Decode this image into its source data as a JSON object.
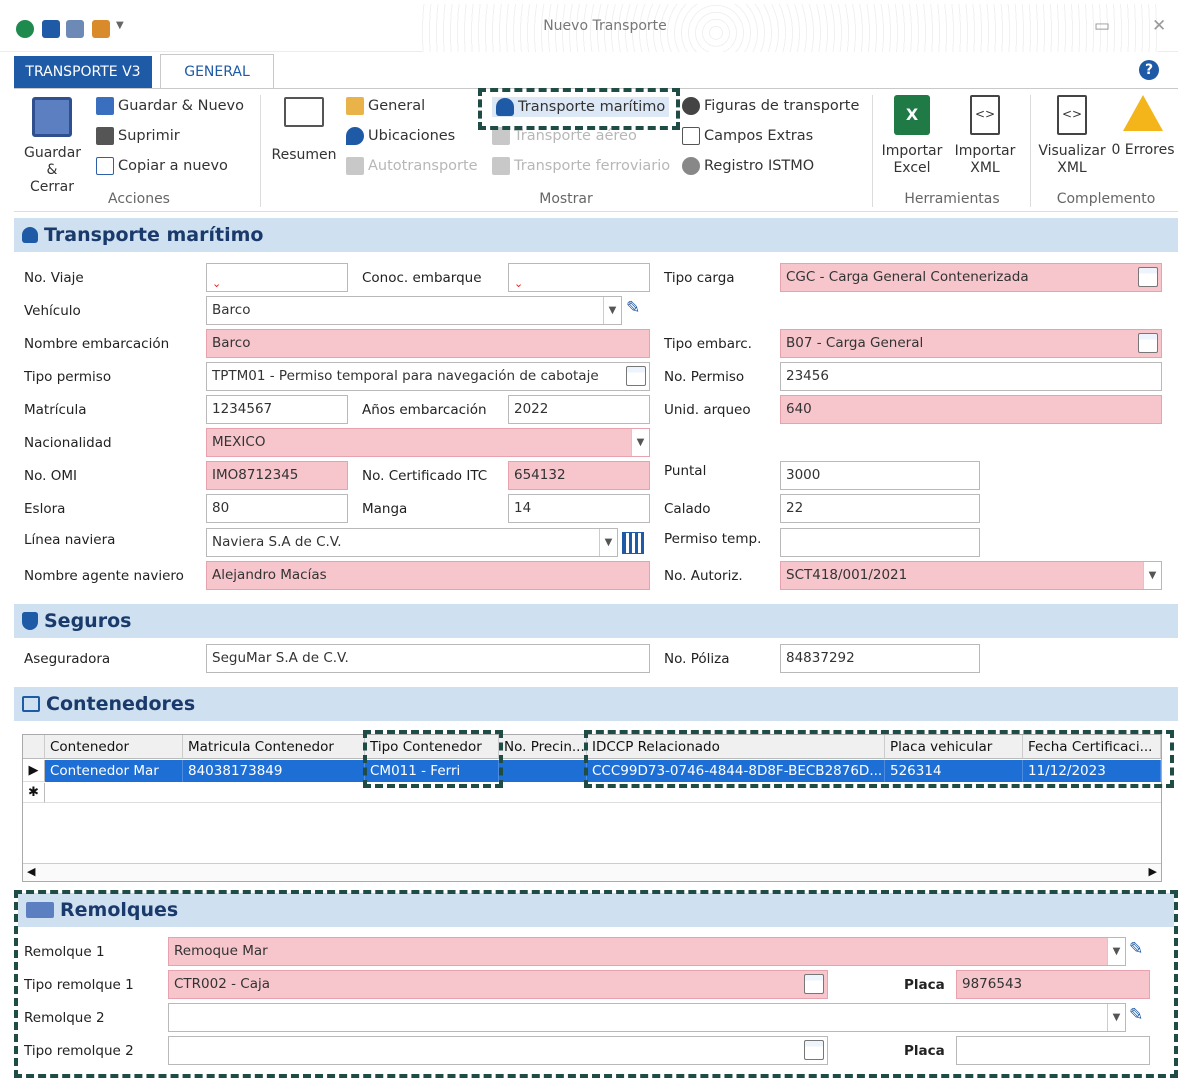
{
  "window": {
    "title": "Nuevo Transporte"
  },
  "tabs": {
    "app": "TRANSPORTE V3",
    "general": "GENERAL"
  },
  "ribbon": {
    "acciones": {
      "save_close": "Guardar & Cerrar",
      "save_new": "Guardar & Nuevo",
      "delete": "Suprimir",
      "copy_new": "Copiar a nuevo",
      "group": "Acciones"
    },
    "mostrar": {
      "resumen": "Resumen",
      "general": "General",
      "ubicaciones": "Ubicaciones",
      "autotransporte": "Autotransporte",
      "maritimo": "Transporte marítimo",
      "aereo": "Transporte aéreo",
      "ferroviario": "Transporte ferroviario",
      "figuras": "Figuras de transporte",
      "campos": "Campos Extras",
      "istmo": "Registro ISTMO",
      "group": "Mostrar"
    },
    "herramientas": {
      "import_excel": "Importar Excel",
      "import_xml": "Importar XML",
      "group": "Herramientas"
    },
    "complemento": {
      "view_xml": "Visualizar XML",
      "errors": "0 Errores",
      "group": "Complemento"
    }
  },
  "maritimo": {
    "title": "Transporte marítimo",
    "no_viaje": {
      "label": "No. Viaje",
      "value": ""
    },
    "conoc": {
      "label": "Conoc. embarque",
      "value": ""
    },
    "tipo_carga": {
      "label": "Tipo carga",
      "value": "CGC - Carga General Contenerizada"
    },
    "vehiculo": {
      "label": "Vehículo",
      "value": "Barco"
    },
    "nombre_emb": {
      "label": "Nombre embarcación",
      "value": "Barco"
    },
    "tipo_embarc": {
      "label": "Tipo embarc.",
      "value": "B07 - Carga General"
    },
    "tipo_permiso": {
      "label": "Tipo permiso",
      "value": "TPTM01 - Permiso temporal para navegación de cabotaje"
    },
    "no_permiso": {
      "label": "No. Permiso",
      "value": "23456"
    },
    "matricula": {
      "label": "Matrícula",
      "value": "1234567"
    },
    "anios": {
      "label": "Años embarcación",
      "value": "2022"
    },
    "unid_arqueo": {
      "label": "Unid. arqueo",
      "value": "640"
    },
    "nacionalidad": {
      "label": "Nacionalidad",
      "value": "MEXICO"
    },
    "no_omi": {
      "label": "No. OMI",
      "value": "IMO8712345"
    },
    "no_cert": {
      "label": "No. Certificado ITC",
      "value": "654132"
    },
    "puntal": {
      "label": "Puntal",
      "value": "3000"
    },
    "eslora": {
      "label": "Eslora",
      "value": "80"
    },
    "manga": {
      "label": "Manga",
      "value": "14"
    },
    "calado": {
      "label": "Calado",
      "value": "22"
    },
    "linea": {
      "label": "Línea naviera",
      "value": "Naviera S.A de C.V."
    },
    "permiso_temp": {
      "label": "Permiso temp.",
      "value": ""
    },
    "agente": {
      "label": "Nombre agente naviero",
      "value": "Alejandro Macías"
    },
    "no_autoriz": {
      "label": "No. Autoriz.",
      "value": "SCT418/001/2021"
    }
  },
  "seguros": {
    "title": "Seguros",
    "aseguradora": {
      "label": "Aseguradora",
      "value": "SeguMar S.A de C.V."
    },
    "poliza": {
      "label": "No. Póliza",
      "value": "84837292"
    }
  },
  "contenedores": {
    "title": "Contenedores",
    "columns": [
      "Contenedor",
      "Matricula Contenedor",
      "Tipo Contenedor",
      "No. Precin...",
      "IDCCP Relacionado",
      "Placa vehicular",
      "Fecha Certificaci..."
    ],
    "row": [
      "Contenedor Mar",
      "84038173849",
      "CM011 - Ferri",
      "",
      "CCC99D73-0746-4844-8D8F-BECB2876D...",
      "526314",
      "11/12/2023"
    ]
  },
  "remolques": {
    "title": "Remolques",
    "r1": {
      "label": "Remolque 1",
      "value": "Remoque Mar"
    },
    "t1": {
      "label": "Tipo remolque 1",
      "value": "CTR002 - Caja"
    },
    "placa1": {
      "label": "Placa",
      "value": "9876543"
    },
    "r2": {
      "label": "Remolque 2",
      "value": ""
    },
    "t2": {
      "label": "Tipo remolque 2",
      "value": ""
    },
    "placa2": {
      "label": "Placa",
      "value": ""
    }
  }
}
